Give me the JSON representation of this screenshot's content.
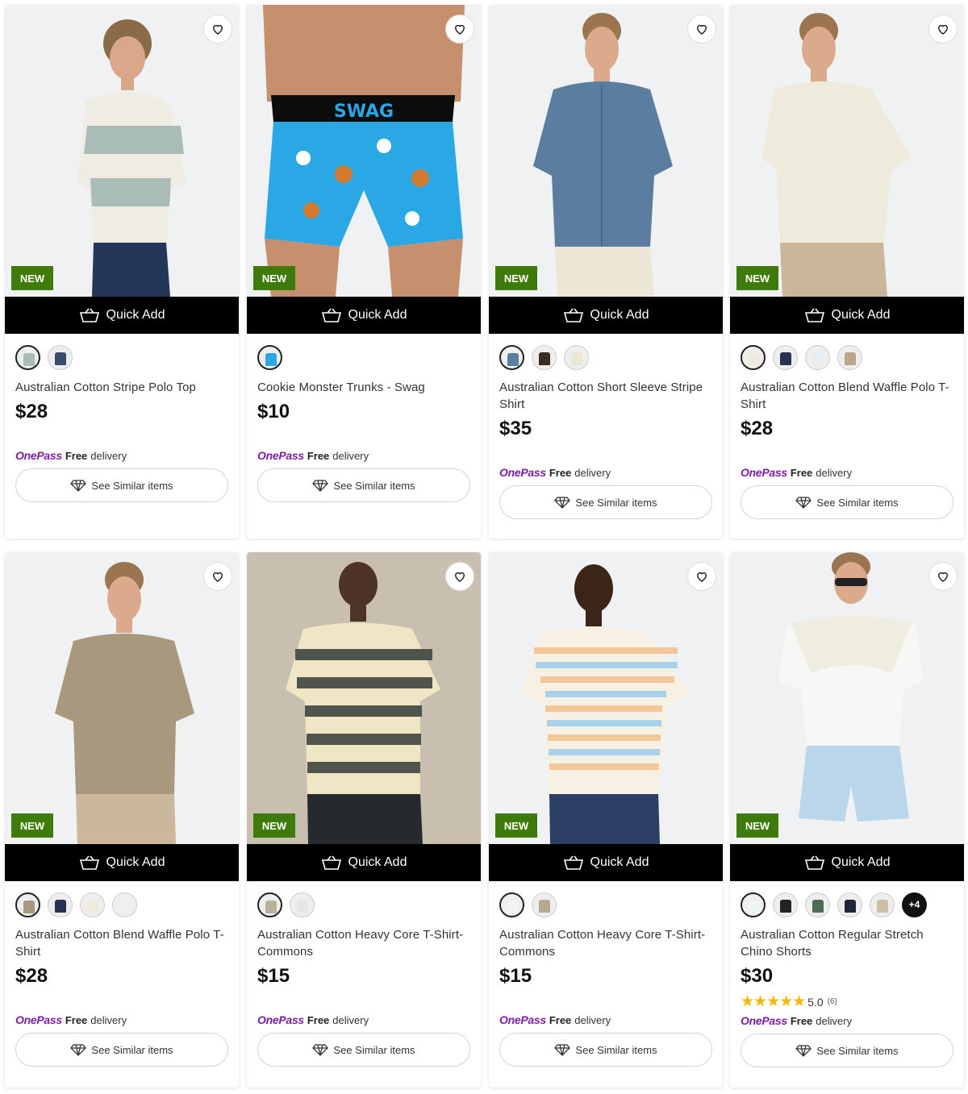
{
  "labels": {
    "new_badge": "NEW",
    "quick_add": "Quick Add",
    "see_similar": "See Similar items",
    "onepass": "OnePass",
    "free": "Free",
    "delivery": "delivery"
  },
  "icons": {
    "wishlist": "heart-outline-icon",
    "quick_add": "basket-icon",
    "see_similar": "diamond-icon"
  },
  "colors": {
    "new_badge_bg": "#3f7b0a",
    "quick_add_bg": "#000000",
    "onepass": "#7b1fa2",
    "star": "#f5b800"
  },
  "products": [
    {
      "title": "Australian Cotton Stripe Polo Top",
      "price": "$28",
      "is_new": true,
      "swatches": [
        "#a9bcb5",
        "#3a4c6a"
      ],
      "more": "",
      "rating": null
    },
    {
      "title": "Cookie Monster Trunks - Swag",
      "price": "$10",
      "is_new": true,
      "swatches": [
        "#2aa8e6"
      ],
      "more": "",
      "rating": null
    },
    {
      "title": "Australian Cotton Short Sleeve Stripe Shirt",
      "price": "$35",
      "is_new": true,
      "swatches": [
        "#5b7ea0",
        "#3a2c22",
        "#ebe5d3"
      ],
      "more": "",
      "rating": null
    },
    {
      "title": "Australian Cotton Blend Waffle Polo T-Shirt",
      "price": "$28",
      "is_new": true,
      "swatches": [
        "#eeeadc",
        "#26324f",
        "#e7eef2",
        "#bba689"
      ],
      "more": "",
      "rating": null
    },
    {
      "title": "Australian Cotton Blend Waffle Polo T-Shirt",
      "price": "$28",
      "is_new": true,
      "swatches": [
        "#a8987e",
        "#26324f",
        "#eeeadc",
        "#eef0f0"
      ],
      "more": "",
      "rating": null
    },
    {
      "title": "Australian Cotton Heavy Core T-Shirt- Commons",
      "price": "$15",
      "is_new": true,
      "swatches": [
        "#b9b29a",
        "#e8e6e2"
      ],
      "more": "",
      "rating": null
    },
    {
      "title": "Australian Cotton Heavy Core T-Shirt- Commons",
      "price": "$15",
      "is_new": true,
      "swatches": [
        "#f3f3f1",
        "#b6a98d"
      ],
      "more": "",
      "rating": null
    },
    {
      "title": "Australian Cotton Regular Stretch Chino Shorts",
      "price": "$30",
      "is_new": true,
      "swatches": [
        "#eef3f6",
        "#222222",
        "#4d6b55",
        "#1e2638",
        "#cbbfa6"
      ],
      "more": "+4",
      "rating": {
        "score": "5.0",
        "count": "(6)",
        "stars": 5
      }
    }
  ]
}
